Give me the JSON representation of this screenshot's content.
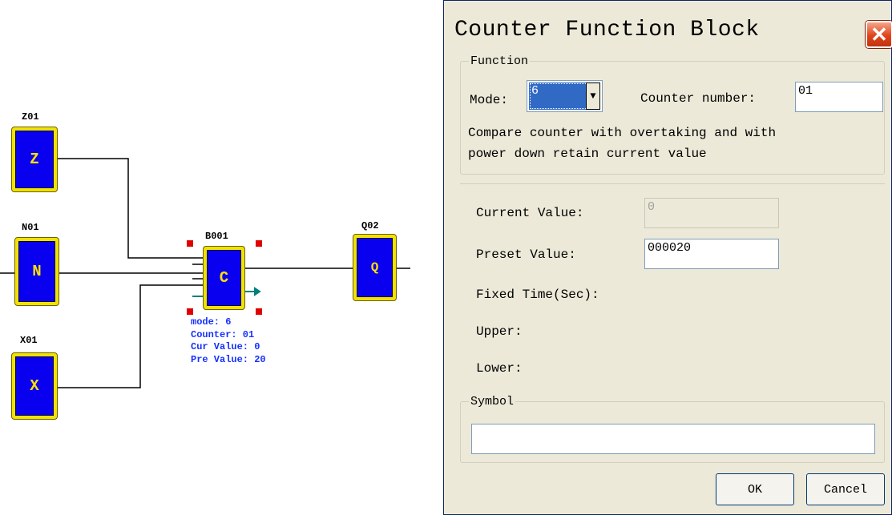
{
  "canvas": {
    "blocks": [
      {
        "id": "z01",
        "label": "Z01",
        "letter": "Z"
      },
      {
        "id": "n01",
        "label": "N01",
        "letter": "N"
      },
      {
        "id": "x01",
        "label": "X01",
        "letter": "X"
      },
      {
        "id": "b001",
        "label": "B001",
        "letter": "C"
      },
      {
        "id": "q02",
        "label": "Q02",
        "letter": "Q"
      }
    ],
    "counter_info": {
      "mode": "mode: 6",
      "counter": "Counter: 01",
      "cur_value": "Cur Value: 0",
      "pre_value": "Pre Value: 20"
    },
    "colors": {
      "block_fill": "#0a00f0",
      "block_border": "#f2e200",
      "handle": "#e00000",
      "info_text": "#1530ff",
      "arrow": "#008080"
    }
  },
  "dialog": {
    "title": "Counter Function Block",
    "close_icon": "close-icon",
    "function_group": {
      "legend": "Function",
      "mode_label": "Mode:",
      "mode_value": "6",
      "counter_number_label": "Counter number:",
      "counter_number_value": "01",
      "description_line1": "Compare counter with overtaking and with",
      "description_line2": "power down retain current value"
    },
    "current_value_label": "Current Value:",
    "current_value": "0",
    "preset_value_label": "Preset Value:",
    "preset_value": "000020",
    "fixed_time_label": "Fixed Time(Sec):",
    "upper_label": "Upper:",
    "lower_label": "Lower:",
    "symbol_group": {
      "legend": "Symbol",
      "value": ""
    },
    "ok_label": "OK",
    "cancel_label": "Cancel"
  }
}
